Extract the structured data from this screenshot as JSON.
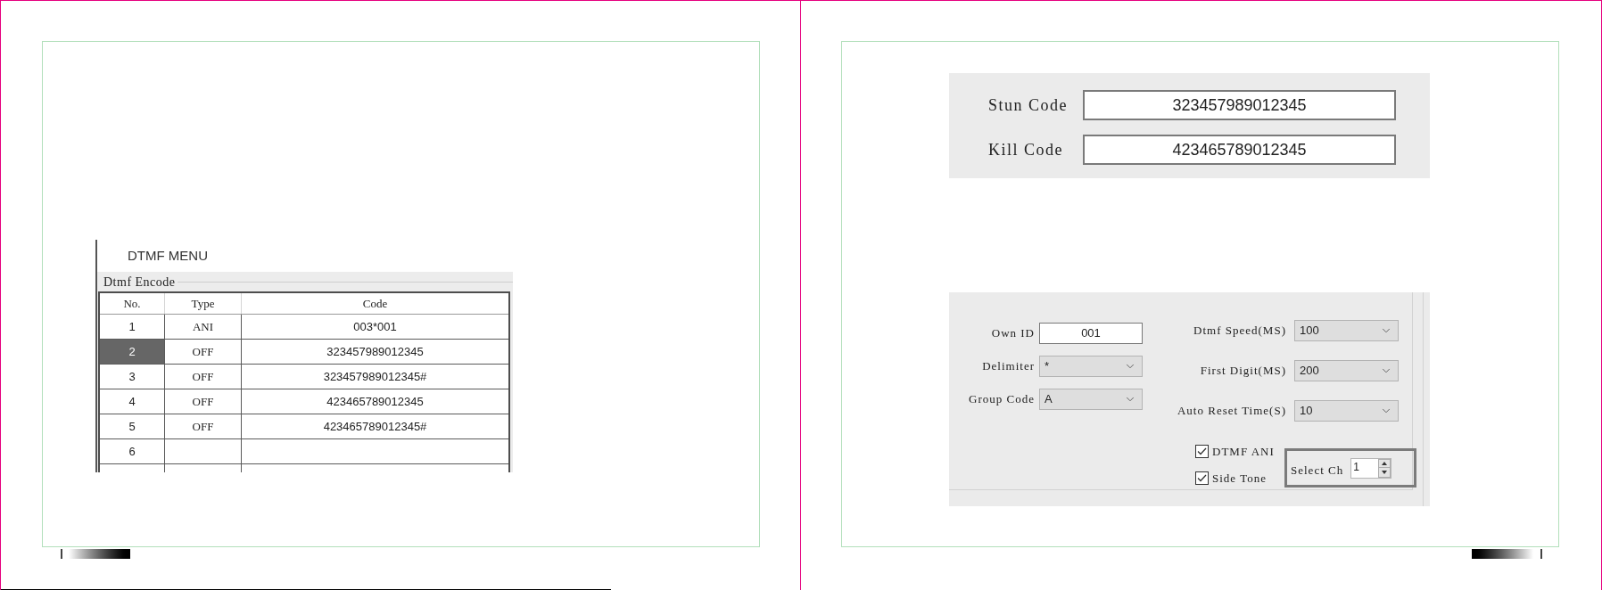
{
  "left_page": {
    "heading": "DTMF MENU",
    "group": {
      "title": "Dtmf Encode"
    },
    "table": {
      "columns": [
        "No.",
        "Type",
        "Code"
      ],
      "rows": [
        {
          "no": "1",
          "type": "ANI",
          "code": "003*001",
          "selected": false
        },
        {
          "no": "2",
          "type": "OFF",
          "code": "323457989012345",
          "selected": true
        },
        {
          "no": "3",
          "type": "OFF",
          "code": "323457989012345#",
          "selected": false
        },
        {
          "no": "4",
          "type": "OFF",
          "code": "423465789012345",
          "selected": false
        },
        {
          "no": "5",
          "type": "OFF",
          "code": "423465789012345#",
          "selected": false
        },
        {
          "no": "6",
          "selected": false
        }
      ]
    }
  },
  "right_page": {
    "codes": [
      {
        "label": "Stun Code",
        "value": "323457989012345"
      },
      {
        "label": "Kill Code",
        "value": "423465789012345"
      }
    ],
    "settings": {
      "left_fields": [
        {
          "kind": "input",
          "label": "Own ID",
          "value": "001"
        },
        {
          "kind": "dropdown",
          "label": "Delimiter",
          "value": "*"
        },
        {
          "kind": "dropdown",
          "label": "Group Code",
          "value": "A"
        }
      ],
      "right_fields": [
        {
          "kind": "dropdown",
          "label": "Dtmf Speed(MS)",
          "value": "100"
        },
        {
          "kind": "dropdown",
          "label": "First Digit(MS)",
          "value": "200"
        },
        {
          "kind": "dropdown",
          "label": "Auto Reset Time(S)",
          "value": "10"
        }
      ],
      "checkboxes": [
        {
          "label": "DTMF ANI",
          "checked": true
        },
        {
          "label": "Side Tone",
          "checked": true
        }
      ],
      "select_ch": {
        "label": "Select Ch",
        "value": "1"
      }
    }
  }
}
